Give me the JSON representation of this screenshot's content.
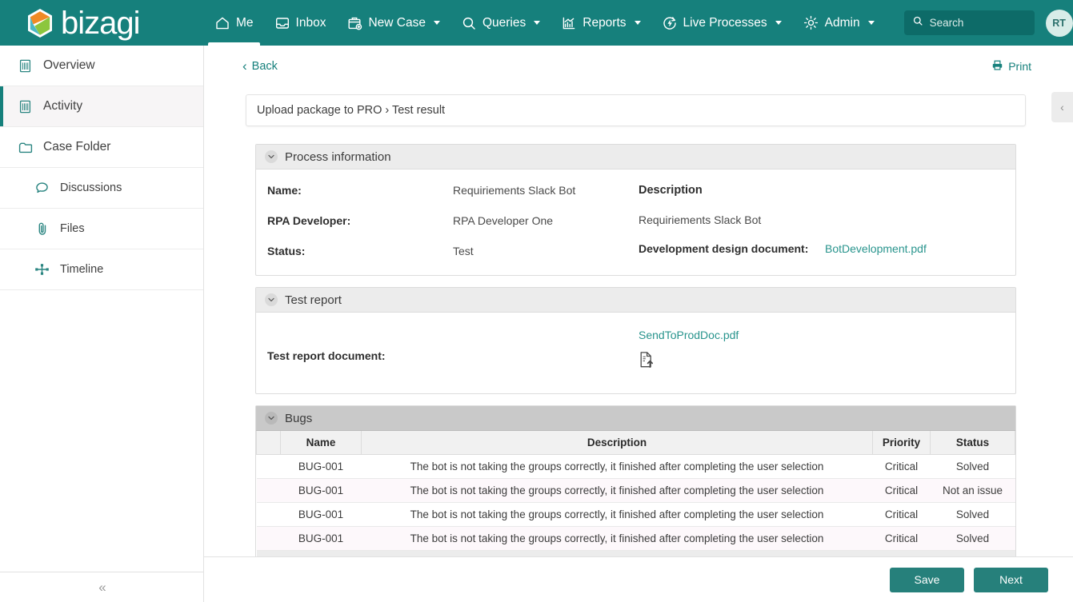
{
  "brand": {
    "name": "bizagi",
    "accent": "#16807c",
    "link": "#28948d"
  },
  "topnav": {
    "items": [
      {
        "label": "Me",
        "icon": "home-icon",
        "active": true,
        "caret": false
      },
      {
        "label": "Inbox",
        "icon": "inbox-icon",
        "active": false,
        "caret": false
      },
      {
        "label": "New Case",
        "icon": "new-case-icon",
        "active": false,
        "caret": true
      },
      {
        "label": "Queries",
        "icon": "search-icon",
        "active": false,
        "caret": true
      },
      {
        "label": "Reports",
        "icon": "reports-chart-icon",
        "active": false,
        "caret": true
      },
      {
        "label": "Live Processes",
        "icon": "live-processes-icon",
        "active": false,
        "caret": true
      },
      {
        "label": "Admin",
        "icon": "gear-icon",
        "active": false,
        "caret": true
      }
    ],
    "search": {
      "placeholder": "Search",
      "value": ""
    },
    "avatar": {
      "initials": "RT"
    }
  },
  "sidebar": {
    "items": [
      {
        "label": "Overview",
        "icon": "document-lines-icon",
        "active": false,
        "sub": false
      },
      {
        "label": "Activity",
        "icon": "document-lines-icon",
        "active": true,
        "sub": false
      },
      {
        "label": "Case Folder",
        "icon": "folder-icon",
        "active": false,
        "sub": false
      },
      {
        "label": "Discussions",
        "icon": "chat-bubble-icon",
        "active": false,
        "sub": true
      },
      {
        "label": "Files",
        "icon": "paperclip-icon",
        "active": false,
        "sub": true
      },
      {
        "label": "Timeline",
        "icon": "timeline-icon",
        "active": false,
        "sub": true
      }
    ],
    "collapse_glyph": "«"
  },
  "header": {
    "back_label": "Back",
    "back_glyph": "‹",
    "print_label": "Print",
    "right_panel_glyph": "‹"
  },
  "breadcrumb": {
    "text": "Upload package to PRO › Test result"
  },
  "sections": {
    "process_information": {
      "title": "Process information",
      "fields": [
        {
          "label": "Name:",
          "value": "Requiriements Slack Bot"
        },
        {
          "label": "RPA Developer:",
          "value": "RPA Developer One"
        },
        {
          "label": "Status:",
          "value": "Test"
        }
      ],
      "description_label": "Description",
      "description_value": "Requiriements Slack Bot",
      "design_doc_label": "Development design document:",
      "design_doc_file": "BotDevelopment.pdf"
    },
    "test_report": {
      "title": "Test report",
      "document_label": "Test report document:",
      "document_file": "SendToProdDoc.pdf",
      "upload_icon": "document-upload-icon"
    },
    "bugs": {
      "title": "Bugs",
      "columns": [
        "Name",
        "Description",
        "Priority",
        "Status"
      ],
      "rows": [
        {
          "name": "BUG-001",
          "description": "The bot is not taking the groups correctly, it finished after completing the user selection",
          "priority": "Critical",
          "status": "Solved"
        },
        {
          "name": "BUG-001",
          "description": "The bot is not taking the groups correctly, it finished after completing the user selection",
          "priority": "Critical",
          "status": "Not an issue"
        },
        {
          "name": "BUG-001",
          "description": "The bot is not taking the groups correctly, it finished after completing the user selection",
          "priority": "Critical",
          "status": "Solved"
        },
        {
          "name": "BUG-001",
          "description": "The bot is not taking the groups correctly, it finished after completing the user selection",
          "priority": "Critical",
          "status": "Solved"
        }
      ]
    }
  },
  "footer": {
    "save_label": "Save",
    "next_label": "Next"
  }
}
